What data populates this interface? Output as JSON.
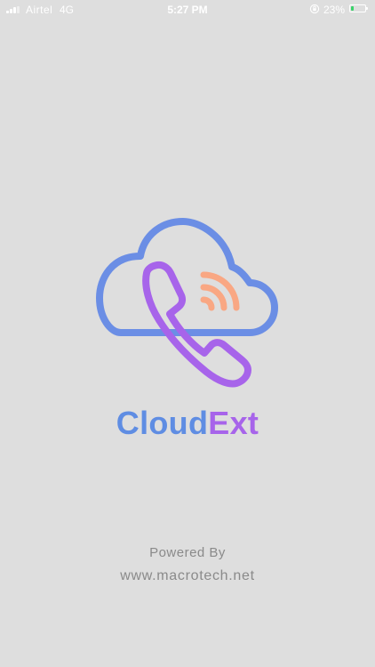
{
  "status_bar": {
    "carrier": "Airtel",
    "network": "4G",
    "time": "5:27 PM",
    "battery_percent": "23%",
    "battery_level": 0.23,
    "icons": [
      "signal-icon",
      "orientation-lock-icon",
      "battery-icon"
    ]
  },
  "brand": {
    "part1": "Cloud",
    "part2": "Ext",
    "colors": {
      "part1": "#5f8de3",
      "part2": "#a764ea",
      "signal_waves": "#f9a783"
    }
  },
  "footer": {
    "powered_by": "Powered By",
    "website": "www.macrotech.net"
  },
  "colors": {
    "background": "#dedede",
    "footer_text": "#8a8a8a"
  }
}
